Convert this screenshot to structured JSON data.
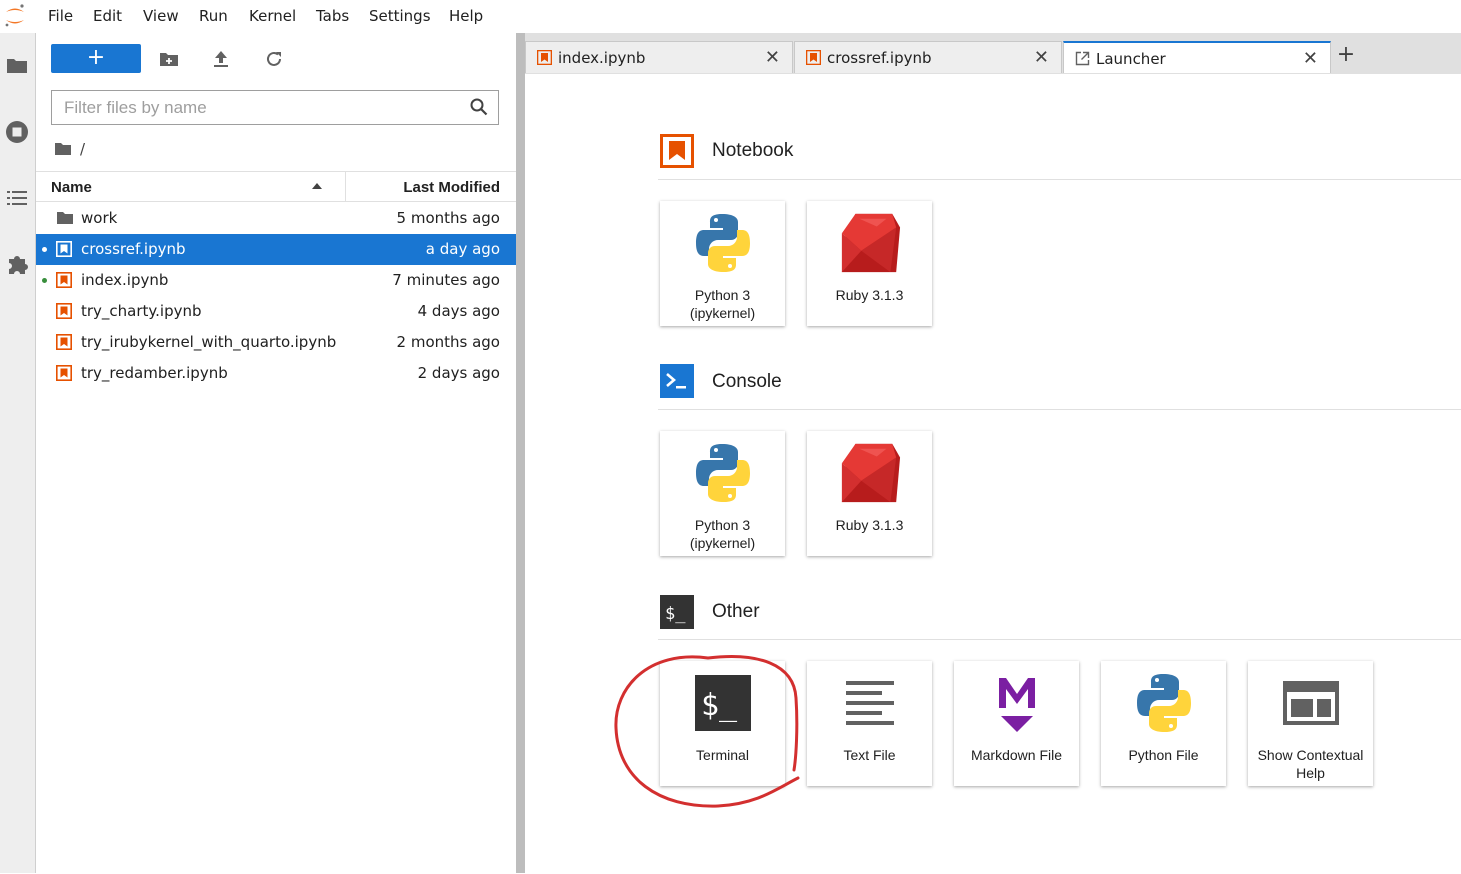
{
  "menubar": {
    "items": [
      "File",
      "Edit",
      "View",
      "Run",
      "Kernel",
      "Tabs",
      "Settings",
      "Help"
    ]
  },
  "activity_bar": {
    "icons": [
      "folder-icon",
      "running-icon",
      "toc-icon",
      "extensions-icon"
    ]
  },
  "file_browser": {
    "new_label": "+",
    "filter_placeholder": "Filter files by name",
    "breadcrumb": "/",
    "columns": {
      "name": "Name",
      "modified": "Last Modified"
    },
    "files": [
      {
        "name": "work",
        "modified": "5 months ago",
        "type": "folder",
        "running": false,
        "selected": false
      },
      {
        "name": "crossref.ipynb",
        "modified": "a day ago",
        "type": "notebook",
        "running": true,
        "selected": true
      },
      {
        "name": "index.ipynb",
        "modified": "7 minutes ago",
        "type": "notebook",
        "running": true,
        "selected": false
      },
      {
        "name": "try_charty.ipynb",
        "modified": "4 days ago",
        "type": "notebook",
        "running": false,
        "selected": false
      },
      {
        "name": "try_irubykernel_with_quarto.ipynb",
        "modified": "2 months ago",
        "type": "notebook",
        "running": false,
        "selected": false
      },
      {
        "name": "try_redamber.ipynb",
        "modified": "2 days ago",
        "type": "notebook",
        "running": false,
        "selected": false
      }
    ]
  },
  "tabs": [
    {
      "label": "index.ipynb",
      "icon": "notebook-icon",
      "close": "✕",
      "active": false
    },
    {
      "label": "crossref.ipynb",
      "icon": "notebook-icon",
      "close": "✕",
      "active": false
    },
    {
      "label": "Launcher",
      "icon": "launcher-icon",
      "close": "✕",
      "active": true
    }
  ],
  "tab_add": "+",
  "launcher": {
    "sections": [
      {
        "title": "Notebook",
        "cards": [
          {
            "label": "Python 3\n(ipykernel)",
            "icon": "python-icon"
          },
          {
            "label": "Ruby 3.1.3",
            "icon": "ruby-icon"
          }
        ]
      },
      {
        "title": "Console",
        "cards": [
          {
            "label": "Python 3\n(ipykernel)",
            "icon": "python-icon"
          },
          {
            "label": "Ruby 3.1.3",
            "icon": "ruby-icon"
          }
        ]
      },
      {
        "title": "Other",
        "cards": [
          {
            "label": "Terminal",
            "icon": "terminal-icon"
          },
          {
            "label": "Text File",
            "icon": "text-file-icon"
          },
          {
            "label": "Markdown File",
            "icon": "markdown-icon"
          },
          {
            "label": "Python File",
            "icon": "python-icon"
          },
          {
            "label": "Show Contextual Help",
            "icon": "contextual-help-icon"
          }
        ]
      }
    ]
  },
  "colors": {
    "accent": "#1976d2",
    "notebook_orange": "#e65100",
    "running_dot": "#388e3c",
    "highlight_red": "#d32f2f"
  }
}
